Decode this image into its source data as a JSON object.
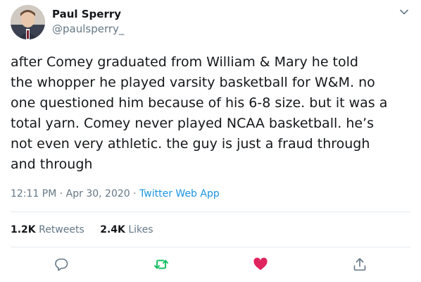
{
  "author": {
    "name": "Paul Sperry",
    "handle": "@paulsperry_"
  },
  "tweet": {
    "text": "after Comey graduated from William & Mary he told\nthe whopper he played varsity basketball for W&M. no\none questioned him because of his 6-8 size. but it was a\ntotal yarn. Comey never played NCAA basketball. he’s\nnot even very athletic. the guy is just a fraud through\nand through",
    "time": "12:11 PM · Apr 30, 2020 · ",
    "app": "Twitter Web App"
  },
  "stats": {
    "retweets_count": "1.2K",
    "retweets_label": "Retweets",
    "likes_count": "2.4K",
    "likes_label": "Likes"
  },
  "icons": {
    "more": "chevron-down-icon",
    "reply": "reply-icon",
    "retweet": "retweet-icon",
    "like": "heart-icon",
    "share": "share-icon"
  },
  "colors": {
    "text": "#14171a",
    "secondary": "#657786",
    "link": "#1b95e0",
    "retweet_active": "#17bf63",
    "like_active": "#e0245e",
    "icon": "#657786"
  }
}
